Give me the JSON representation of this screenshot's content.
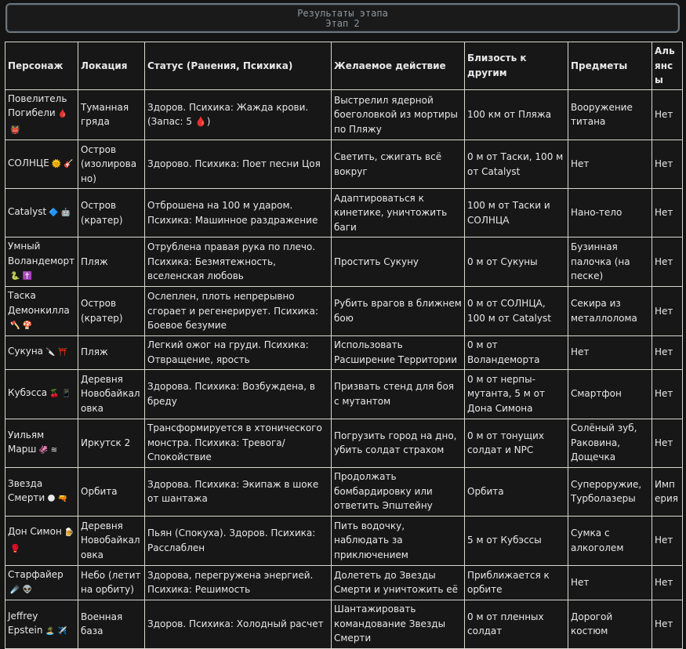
{
  "header": {
    "title": "Результаты этапа",
    "subtitle": "Этап 2"
  },
  "columns": [
    "Персонаж",
    "Локация",
    "Статус (Ранения, Психика)",
    "Желаемое действие",
    "Близость к другим",
    "Предметы",
    "Альянсы"
  ],
  "rows": [
    {
      "name": "Повелитель Погибели",
      "icons": [
        {
          "id": "blood-drop-icon",
          "glyph": "🩸"
        },
        {
          "id": "demon-icon",
          "glyph": "👹"
        }
      ],
      "location": "Туманная гряда",
      "status": "Здоров. Психика: Жажда крови. (Запас: 5 🩸)",
      "action": "Выстрелил ядерной боеголовкой из мортиры по Пляжу",
      "proximity": "100 км от Пляжа",
      "items": "Вооружение титана",
      "alliances": "Нет"
    },
    {
      "name": "СОЛНЦЕ",
      "icons": [
        {
          "id": "sun-icon",
          "glyph": "🌞"
        },
        {
          "id": "guitar-icon",
          "glyph": "🎸"
        }
      ],
      "location": "Остров (изолировано)",
      "status": "Здорово. Психика: Поет песни Цоя",
      "action": "Светить, сжигать всё вокруг",
      "proximity": "0 м от Таски, 100 м от Catalyst",
      "items": "Нет",
      "alliances": "Нет"
    },
    {
      "name": "Catalyst",
      "icons": [
        {
          "id": "crystal-icon",
          "glyph": "🔷"
        },
        {
          "id": "robot-icon",
          "glyph": "🤖"
        }
      ],
      "location": "Остров (кратер)",
      "status": "Отброшена на 100 м ударом. Психика: Машинное раздражение",
      "action": "Адаптироваться к кинетике, уничтожить баги",
      "proximity": "100 м от Таски и СОЛНЦА",
      "items": "Нано-тело",
      "alliances": "Нет"
    },
    {
      "name": "Умный Воландеморт",
      "icons": [
        {
          "id": "snake-icon",
          "glyph": "🐍"
        },
        {
          "id": "cross-icon",
          "glyph": "✝️"
        }
      ],
      "location": "Пляж",
      "status": "Отрублена правая рука по плечо. Психика: Безмятежность, вселенская любовь",
      "action": "Простить Сукуну",
      "proximity": "0 м от Сукуны",
      "items": "Бузинная палочка (на песке)",
      "alliances": "Нет"
    },
    {
      "name": "Таска Демонкилла",
      "icons": [
        {
          "id": "axe-icon",
          "glyph": "🪓"
        },
        {
          "id": "mushroom-icon",
          "glyph": "🍄"
        }
      ],
      "location": "Остров (кратер)",
      "status": "Ослеплен, плоть непрерывно сгорает и регенерирует. Психика: Боевое безумие",
      "action": "Рубить врагов в ближнем бою",
      "proximity": "0 м от СОЛНЦА, 100 м от Catalyst",
      "items": "Секира из металлолома",
      "alliances": "Нет"
    },
    {
      "name": "Сукуна",
      "icons": [
        {
          "id": "knife-icon",
          "glyph": "🔪"
        },
        {
          "id": "torii-icon",
          "glyph": "⛩️"
        }
      ],
      "location": "Пляж",
      "status": "Легкий ожог на груди. Психика: Отвращение, ярость",
      "action": "Использовать Расширение Территории",
      "proximity": "0 м от Воландеморта",
      "items": "Нет",
      "alliances": "Нет"
    },
    {
      "name": "Кубэсса",
      "icons": [
        {
          "id": "cherries-icon",
          "glyph": "🍒"
        },
        {
          "id": "phone-icon",
          "glyph": "📱"
        }
      ],
      "location": "Деревня Новобайкаловка",
      "status": "Здорова. Психика: Возбуждена, в бреду",
      "action": "Призвать стенд для боя с мутантом",
      "proximity": "0 м от нерпы-мутанта, 5 м от Дона Симона",
      "items": "Смартфон",
      "alliances": "Нет"
    },
    {
      "name": "Уильям Марш",
      "icons": [
        {
          "id": "squid-icon",
          "glyph": "🦑"
        },
        {
          "id": "waves-icon",
          "glyph": "≋"
        }
      ],
      "location": "Иркутск 2",
      "status": "Трансформируется в хтонического монстра. Психика: Тревога/Спокойствие",
      "action": "Погрузить город на дно, убить солдат страхом",
      "proximity": "0 м от тонущих солдат и NPC",
      "items": "Солёный зуб, Раковина, Дощечка",
      "alliances": "Нет"
    },
    {
      "name": "Звезда Смерти",
      "icons": [
        {
          "id": "moon-icon",
          "glyph": "🌑"
        },
        {
          "id": "blaster-icon",
          "glyph": "🔫"
        }
      ],
      "location": "Орбита",
      "status": "Здорова. Психика: Экипаж в шоке от шантажа",
      "action": "Продолжать бомбардировку или ответить Эпштейну",
      "proximity": "Орбита",
      "items": "Супероружие, Турболазеры",
      "alliances": "Империя"
    },
    {
      "name": "Дон Симон",
      "icons": [
        {
          "id": "beer-icon",
          "glyph": "🍺"
        },
        {
          "id": "boxing-glove-icon",
          "glyph": "🥊"
        }
      ],
      "location": "Деревня Новобайкаловка",
      "status": "Пьян (Спокуха). Здоров. Психика: Расслаблен",
      "action": "Пить водочку, наблюдать за приключением",
      "proximity": "5 м от Кубэссы",
      "items": "Сумка с алкоголем",
      "alliances": "Нет"
    },
    {
      "name": "Старфайер",
      "icons": [
        {
          "id": "comet-icon",
          "glyph": "☄️"
        },
        {
          "id": "alien-icon",
          "glyph": "👽"
        }
      ],
      "location": "Небо (летит на орбиту)",
      "status": "Здорова, перегружена энергией. Психика: Решимость",
      "action": "Долететь до Звезды Смерти и уничтожить её",
      "proximity": "Приближается к орбите",
      "items": "Нет",
      "alliances": "Нет"
    },
    {
      "name": "Jeffrey Epstein",
      "icons": [
        {
          "id": "island-icon",
          "glyph": "🏝️"
        },
        {
          "id": "airplane-icon",
          "glyph": "✈️"
        }
      ],
      "location": "Военная база",
      "status": "Здоров. Психика: Холодный расчет",
      "action": "Шантажировать командование Звезды Смерти",
      "proximity": "0 м от пленных солдат",
      "items": "Дорогой костюм",
      "alliances": "Нет"
    }
  ]
}
